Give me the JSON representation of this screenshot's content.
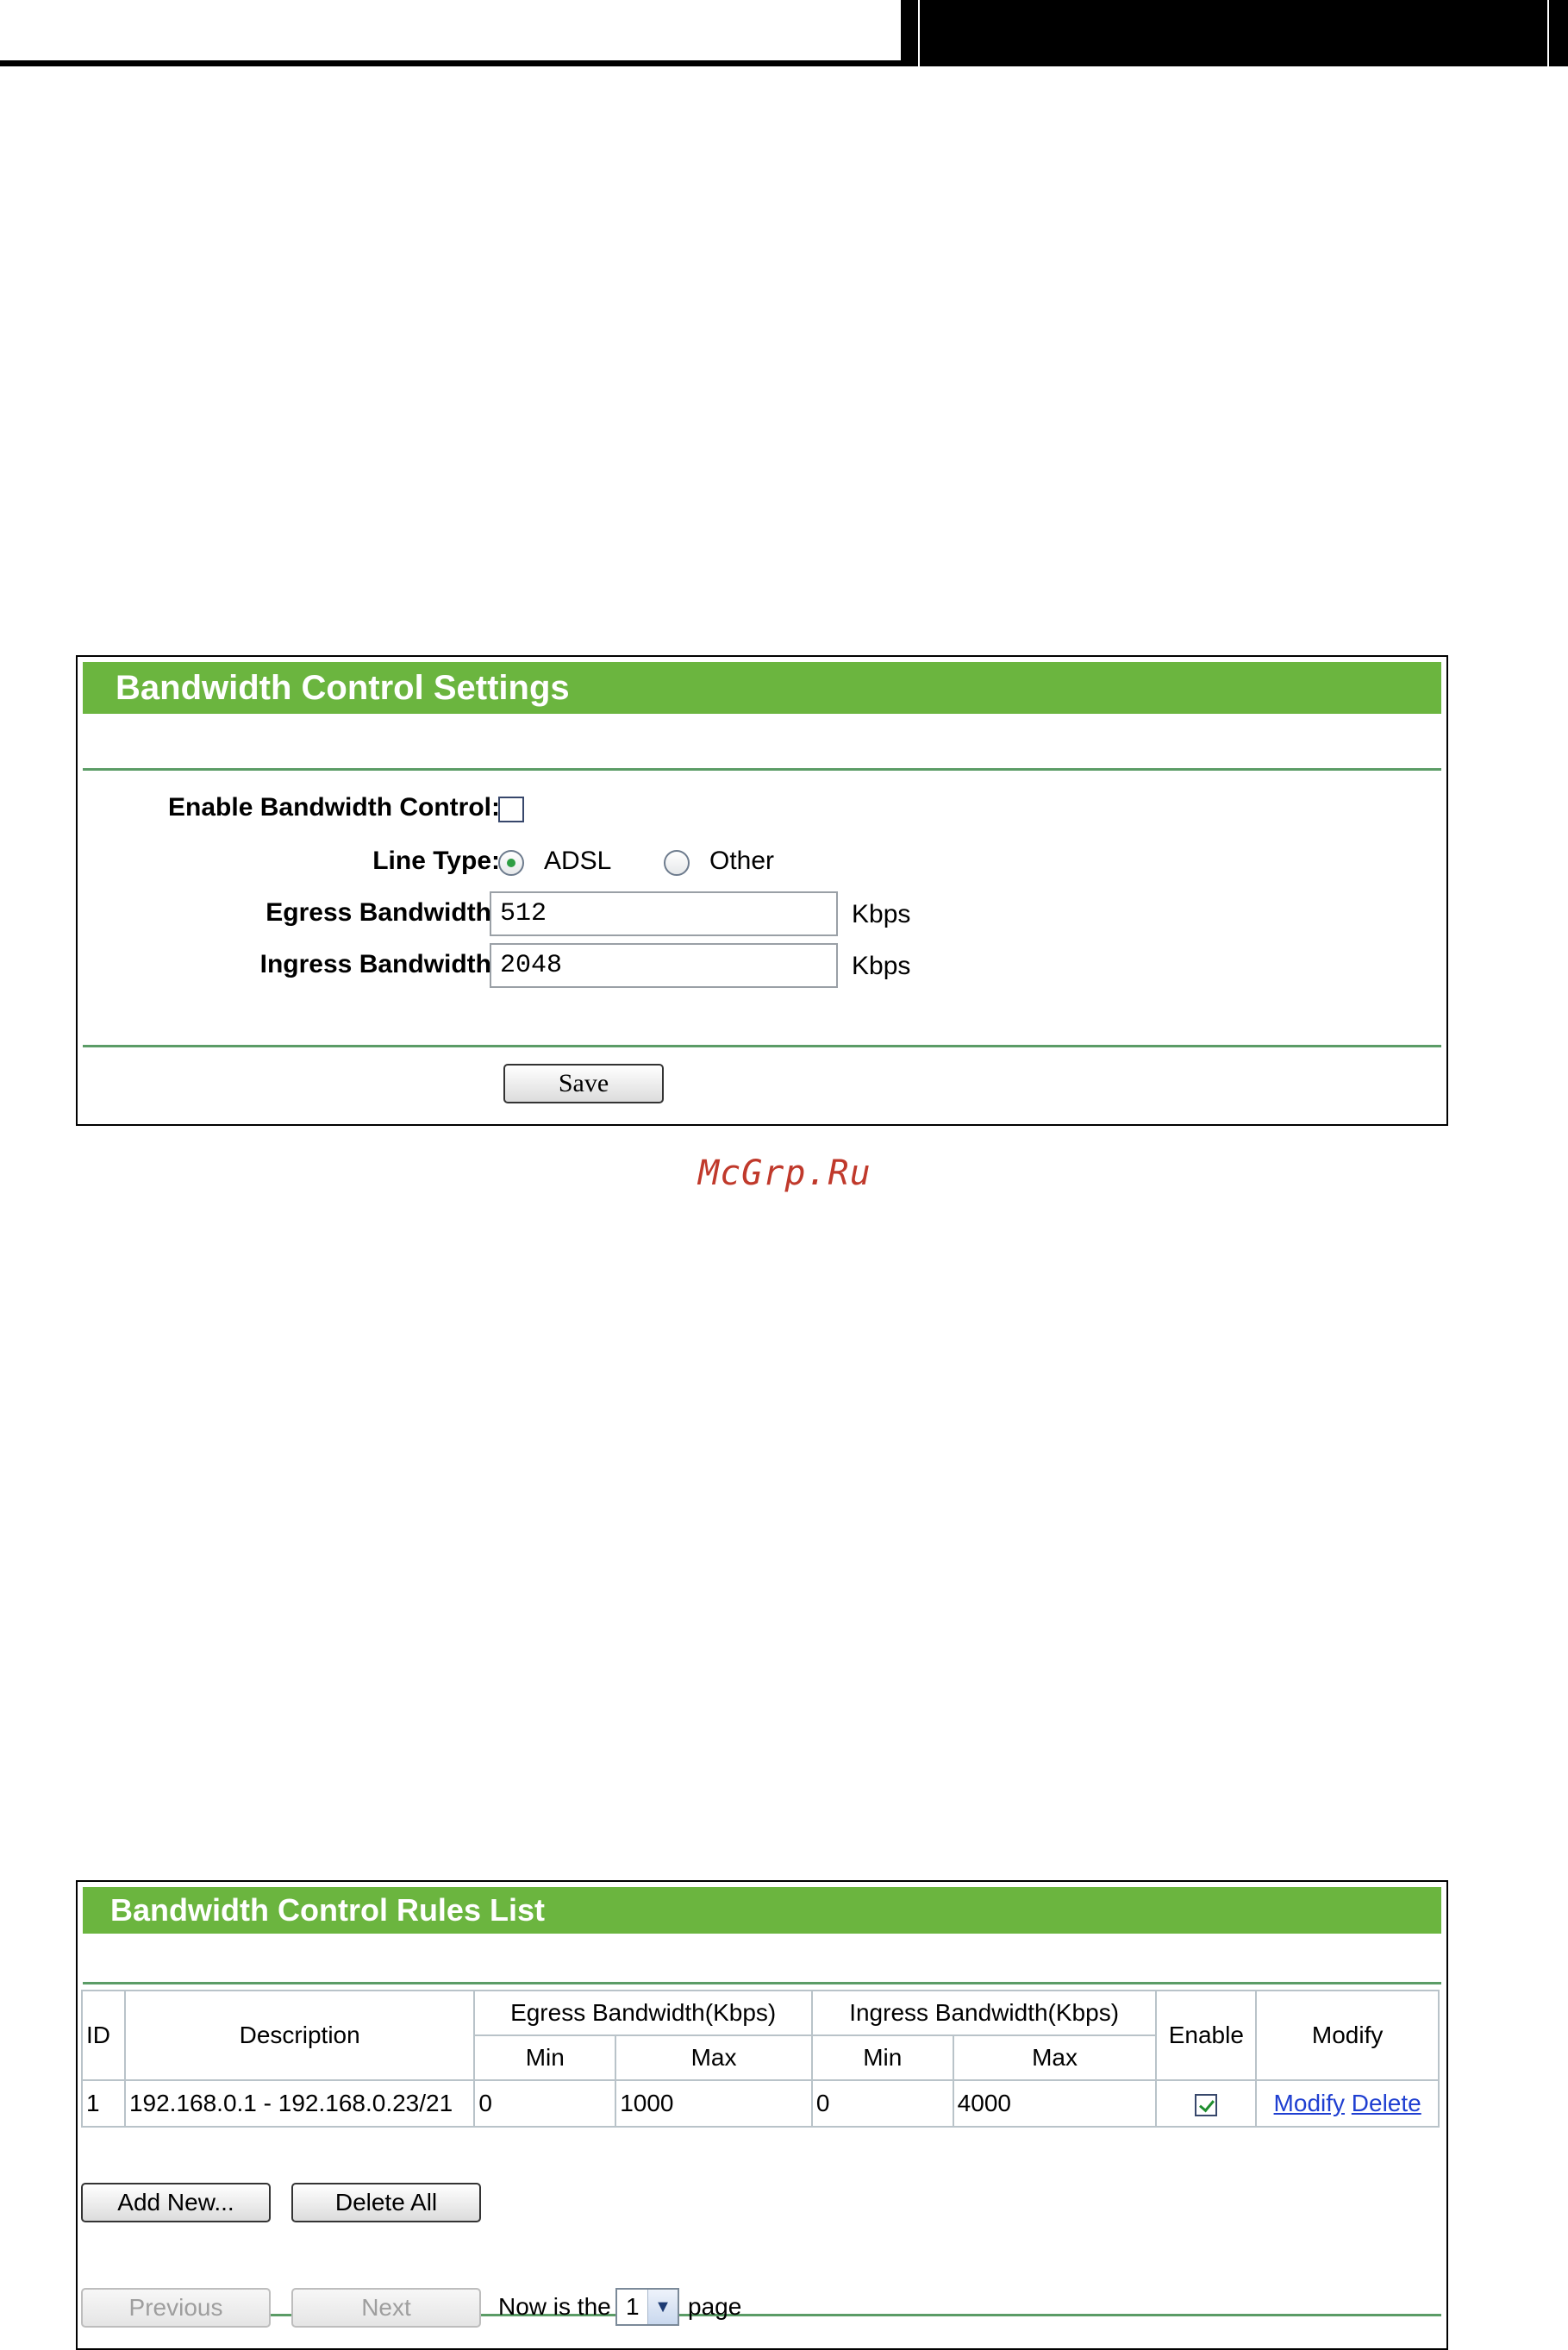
{
  "settings": {
    "title": "Bandwidth Control Settings",
    "enable_label": "Enable Bandwidth Control:",
    "line_type_label": "Line Type:",
    "line_type_options": [
      "ADSL",
      "Other"
    ],
    "line_type_selected": "ADSL",
    "egress_label": "Egress Bandwidth:",
    "egress_value": "512",
    "ingress_label": "Ingress Bandwidth:",
    "ingress_value": "2048",
    "unit": "Kbps",
    "save_label": "Save"
  },
  "watermark": "McGrp.Ru",
  "rules": {
    "title": "Bandwidth Control Rules List",
    "headers": {
      "id": "ID",
      "description": "Description",
      "egress": "Egress Bandwidth(Kbps)",
      "ingress": "Ingress Bandwidth(Kbps)",
      "min": "Min",
      "max": "Max",
      "enable": "Enable",
      "modify": "Modify"
    },
    "rows": [
      {
        "id": "1",
        "description": "192.168.0.1 - 192.168.0.23/21",
        "egress_min": "0",
        "egress_max": "1000",
        "ingress_min": "0",
        "ingress_max": "4000",
        "enabled": true,
        "modify_label": "Modify",
        "delete_label": "Delete"
      }
    ],
    "add_new_label": "Add New...",
    "delete_all_label": "Delete All",
    "previous_label": "Previous",
    "next_label": "Next",
    "page_prefix": "Now is the",
    "page_value": "1",
    "page_suffix": "page"
  }
}
